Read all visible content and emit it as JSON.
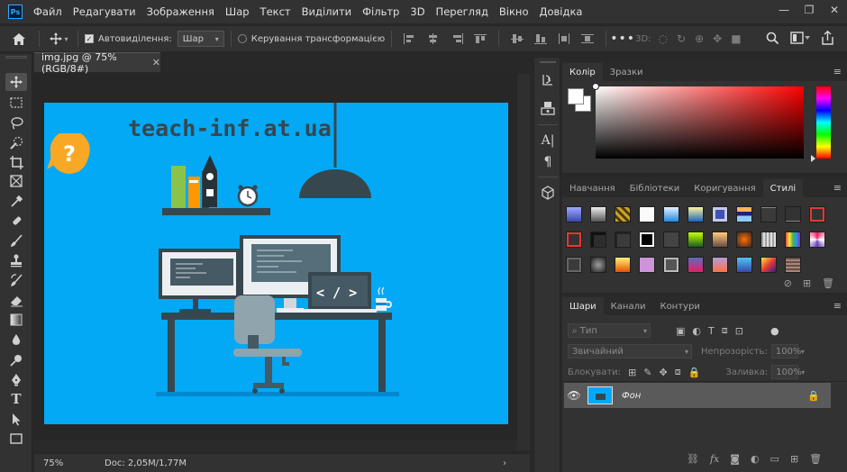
{
  "app": {
    "logo": "Ps"
  },
  "menu": [
    "Файл",
    "Редагувати",
    "Зображення",
    "Шар",
    "Текст",
    "Виділити",
    "Фільтр",
    "3D",
    "Перегляд",
    "Вікно",
    "Довідка"
  ],
  "window_controls": {
    "minimize": "—",
    "restore": "❐",
    "close": "✕"
  },
  "options": {
    "auto_select_label": "Автовиділення:",
    "auto_select_checked": true,
    "auto_select_value": "Шар",
    "transform_label": "Керування трансформацією",
    "mode_3d": "3D:"
  },
  "document": {
    "tab_title": "img.jpg @ 75% (RGB/8#)",
    "close_glyph": "✕",
    "zoom": "75%",
    "doc_size": "Doc: 2,05M/1,77M",
    "arrow": "›"
  },
  "image": {
    "site_text": "teach-inf.at.ua",
    "code_tag": "< / >",
    "bubble_text": "?"
  },
  "color_panel": {
    "tabs": [
      "Колір",
      "Зразки"
    ],
    "active_tab": "Колір",
    "foreground": "#ffffff",
    "background": "#ffffff"
  },
  "styles_panel": {
    "tabs": [
      "Навчання",
      "Бібліотеки",
      "Коригування",
      "Стилі"
    ],
    "active_tab": "Стилі"
  },
  "layers_panel": {
    "tabs": [
      "Шари",
      "Канали",
      "Контури"
    ],
    "active_tab": "Шари",
    "search_placeholder": "Тип",
    "blend_mode": "Звичайний",
    "opacity_label": "Непрозорість:",
    "opacity_value": "100%",
    "lock_label": "Блокувати:",
    "fill_label": "Заливка:",
    "fill_value": "100%",
    "layers": [
      {
        "name": "Фон",
        "visible": true,
        "locked": true
      }
    ]
  }
}
